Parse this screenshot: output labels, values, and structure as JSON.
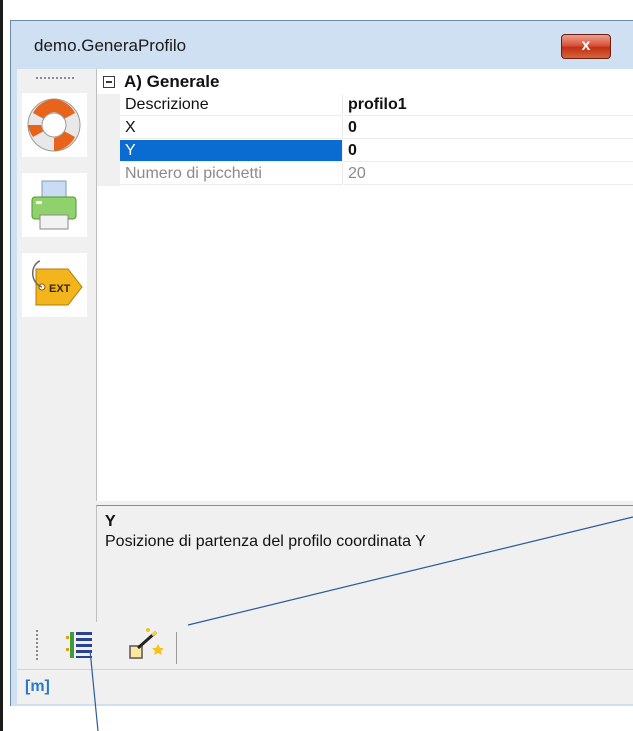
{
  "window": {
    "title": "demo.GeneraProfilo",
    "close_label": "x"
  },
  "side_toolbar": {
    "items": [
      {
        "icon": "lifebuoy-icon"
      },
      {
        "icon": "printer-icon"
      },
      {
        "icon": "ext-tag-icon",
        "label": "EXT"
      }
    ]
  },
  "property_grid": {
    "category": "A) Generale",
    "rows": [
      {
        "name": "Descrizione",
        "value": "profilo1",
        "bold": true
      },
      {
        "name": "X",
        "value": "0",
        "bold": true
      },
      {
        "name": "Y",
        "value": "0",
        "bold": true,
        "selected": true
      },
      {
        "name": "Numero di picchetti",
        "value": "20",
        "readonly": true
      }
    ]
  },
  "description_panel": {
    "title": "Y",
    "text": "Posizione di partenza del profilo coordinata Y"
  },
  "bottom_toolbar": {
    "items": [
      {
        "icon": "categorized-list-icon"
      },
      {
        "icon": "magic-wand-icon"
      }
    ]
  },
  "status_bar": {
    "unit": "[m]"
  },
  "colors": {
    "selection": "#0a6bd1",
    "window_frame": "#cfe0f3",
    "status_text": "#2a79c9",
    "close_button": "#c22f14",
    "annotation_line": "#2a5a9a"
  }
}
